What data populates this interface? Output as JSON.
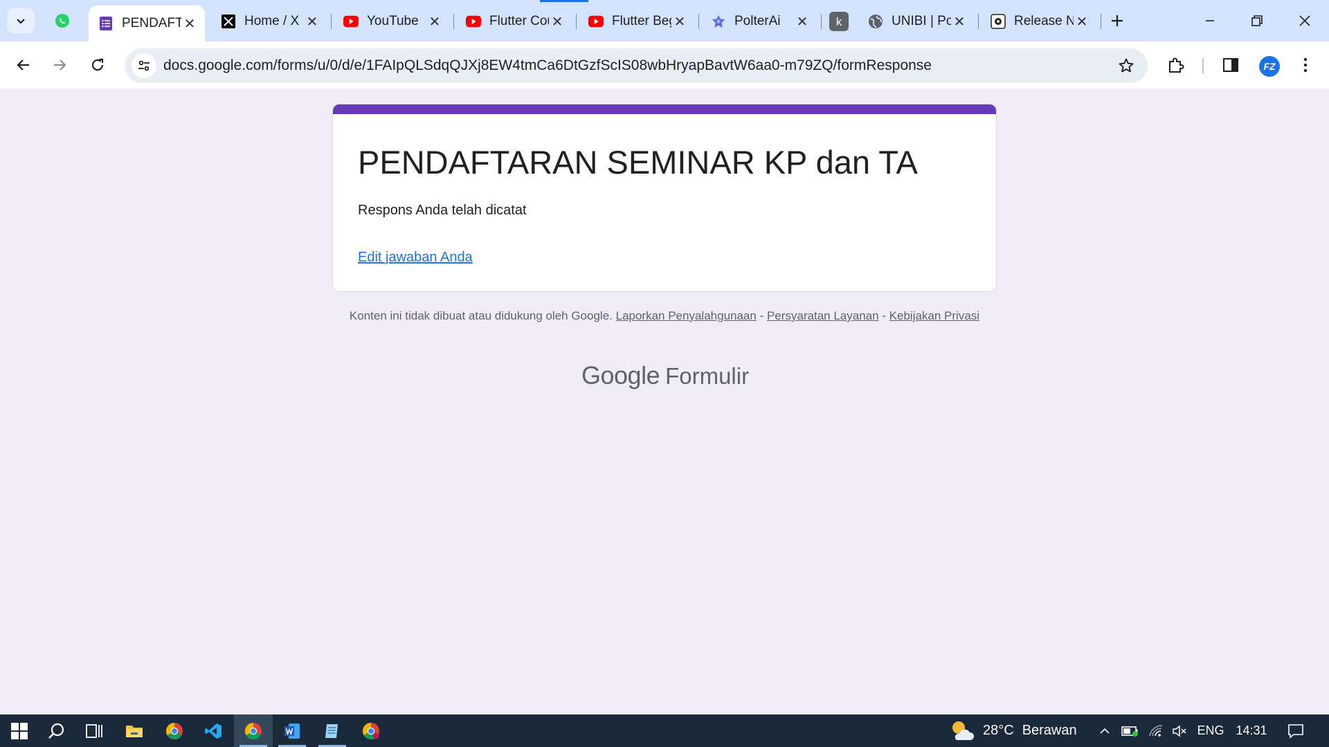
{
  "browser": {
    "tabs": [
      {
        "title": "PENDAFTARAN SEMINAR KP dan TA",
        "icon": "google-forms-icon",
        "active": true
      },
      {
        "title": "Home / X",
        "icon": "x-logo-icon"
      },
      {
        "title": "YouTube",
        "icon": "youtube-icon"
      },
      {
        "title": "Flutter Course",
        "icon": "youtube-icon"
      },
      {
        "title": "Flutter Beginner",
        "icon": "youtube-icon"
      },
      {
        "title": "PolterAi",
        "icon": "polterai-icon"
      },
      {
        "title": "",
        "icon": "k-letter-icon"
      },
      {
        "title": "UNIBI | Portal",
        "icon": "globe-icon"
      },
      {
        "title": "Release Notes",
        "icon": "release-icon"
      }
    ],
    "close_glyph": "✕",
    "new_tab_glyph": "+",
    "url": "docs.google.com/forms/u/0/d/e/1FAIpQLSdqQJXj8EW4tmCa6DtGzfScIS08wbHryapBavtW6aa0-m79ZQ/formResponse",
    "profile_initials": "FZ"
  },
  "form": {
    "title": "PENDAFTARAN SEMINAR KP dan TA",
    "message": "Respons Anda telah dicatat",
    "edit_link": "Edit jawaban Anda",
    "accent_color": "#673ab7"
  },
  "footer": {
    "disclaimer": "Konten ini tidak dibuat atau didukung oleh Google.",
    "report_link": "Laporkan Penyalahgunaan",
    "terms_link": "Persyaratan Layanan",
    "privacy_link": "Kebijakan Privasi",
    "separator": " - ",
    "brand_google": "Google",
    "brand_product": "Formulir"
  },
  "taskbar": {
    "apps": [
      "windows-start-icon",
      "search-icon",
      "task-view-icon",
      "file-explorer-icon",
      "chrome-icon",
      "vscode-icon",
      "chrome-icon",
      "word-icon",
      "notepad-icon",
      "chrome-icon"
    ],
    "weather_temp": "28°C",
    "weather_condition": "Berawan",
    "language": "ENG",
    "time": "14:31"
  }
}
